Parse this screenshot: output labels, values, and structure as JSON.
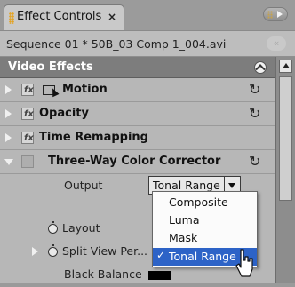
{
  "panel": {
    "tab_title": "Effect Controls",
    "tab_close": "×",
    "sequence": "Sequence 01 * 50B_03 Comp 1_004.avi",
    "sequence_collapse": "«"
  },
  "effects": {
    "header": "Video Effects",
    "rows": [
      {
        "label": "Motion",
        "reset": "↻"
      },
      {
        "label": "Opacity",
        "reset": "↻"
      },
      {
        "label": "Time Remapping"
      },
      {
        "label": "Three-Way Color Corrector",
        "reset": "↻"
      }
    ],
    "properties": {
      "output_label": "Output",
      "output_value": "Tonal Range",
      "layout_label": "Layout",
      "split_view_label": "Split View Per...",
      "black_balance_label": "Black Balance",
      "black_balance_color": "#000000"
    }
  },
  "dropdown": {
    "options": [
      "Composite",
      "Luma",
      "Mask",
      "Tonal Range"
    ],
    "selected": "Tonal Range",
    "check_glyph": "✓"
  },
  "colors": {
    "selection": "#2d63c7",
    "grip": "#e3a324"
  }
}
